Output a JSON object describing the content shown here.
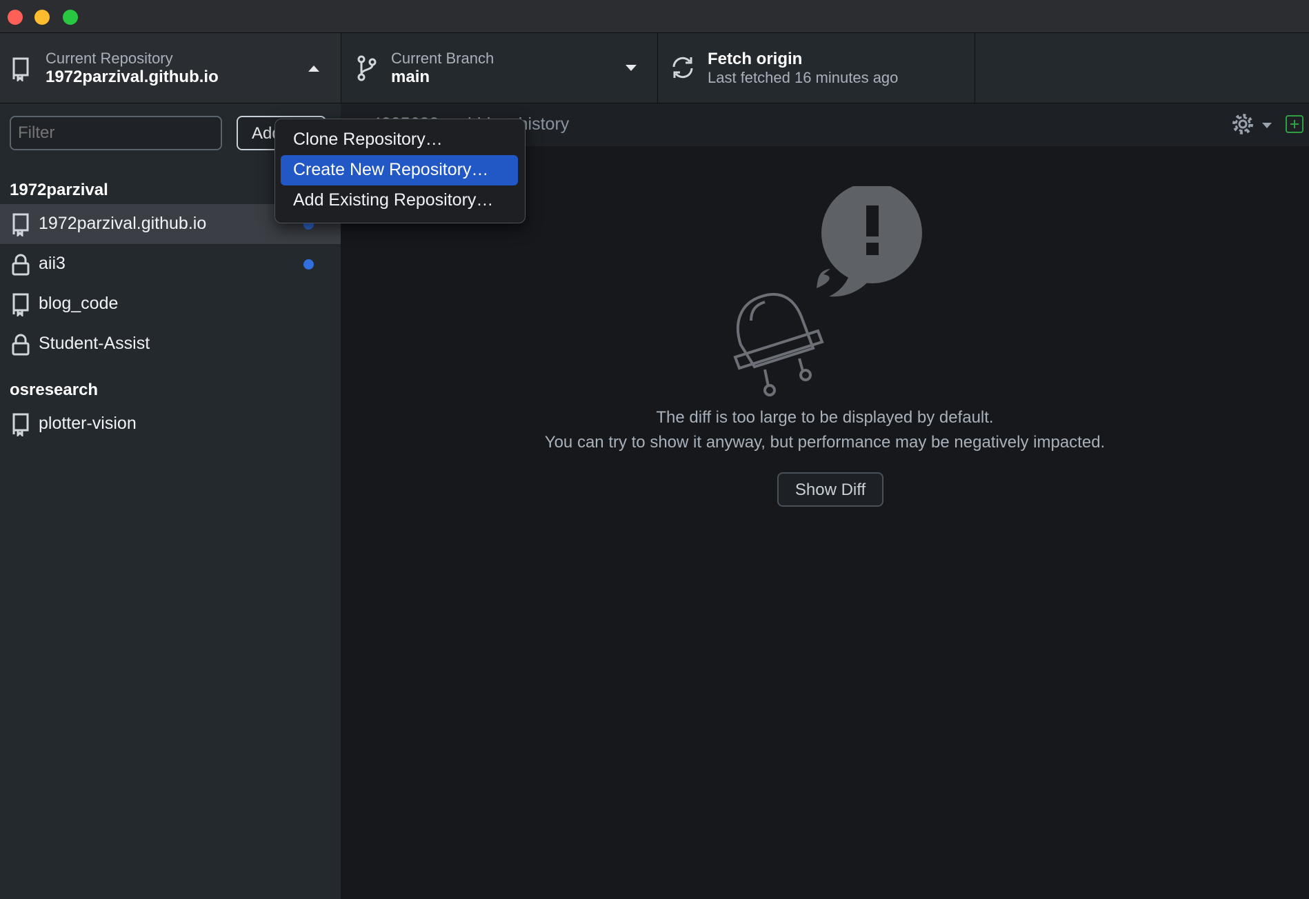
{
  "window": {
    "controls": [
      "close",
      "minimize",
      "zoom"
    ]
  },
  "toolbar": {
    "repository": {
      "label": "Current Repository",
      "value": "1972parzival.github.io",
      "icon": "repo-icon",
      "caret": "caret-up-icon"
    },
    "branch": {
      "label": "Current Branch",
      "value": "main",
      "icon": "branch-icon",
      "caret": "caret-down-icon"
    },
    "fetch": {
      "title": "Fetch origin",
      "subtitle": "Last fetched 16 minutes ago",
      "icon": "sync-icon"
    }
  },
  "sidebar": {
    "filter_placeholder": "Filter",
    "add_label": "Add",
    "groups": [
      {
        "name": "1972parzival",
        "repos": [
          {
            "name": "1972parzival.github.io",
            "icon": "repo-icon",
            "selected": true,
            "dot": true
          },
          {
            "name": "aii3",
            "icon": "lock-icon",
            "selected": false,
            "dot": true
          },
          {
            "name": "blog_code",
            "icon": "repo-icon",
            "selected": false,
            "dot": false
          },
          {
            "name": "Student-Assist",
            "icon": "lock-icon",
            "selected": false,
            "dot": false
          }
        ]
      },
      {
        "name": "osresearch",
        "repos": [
          {
            "name": "plotter-vision",
            "icon": "repo-icon",
            "selected": false,
            "dot": false
          }
        ]
      }
    ]
  },
  "add_menu": {
    "items": [
      {
        "label": "Clone Repository…",
        "highlighted": false
      },
      {
        "label": "Create New Repository…",
        "highlighted": true
      },
      {
        "label": "Add Existing Repository…",
        "highlighted": false
      }
    ]
  },
  "main": {
    "file_path": "…4205632.mobirise_history",
    "message_line1": "The diff is too large to be displayed by default.",
    "message_line2": "You can try to show it anyway, but performance may be negatively impacted.",
    "show_diff_label": "Show Diff"
  },
  "colors": {
    "accent": "#2257c6",
    "unread_dot": "#2f6fde",
    "add_file": "#2ea043"
  }
}
